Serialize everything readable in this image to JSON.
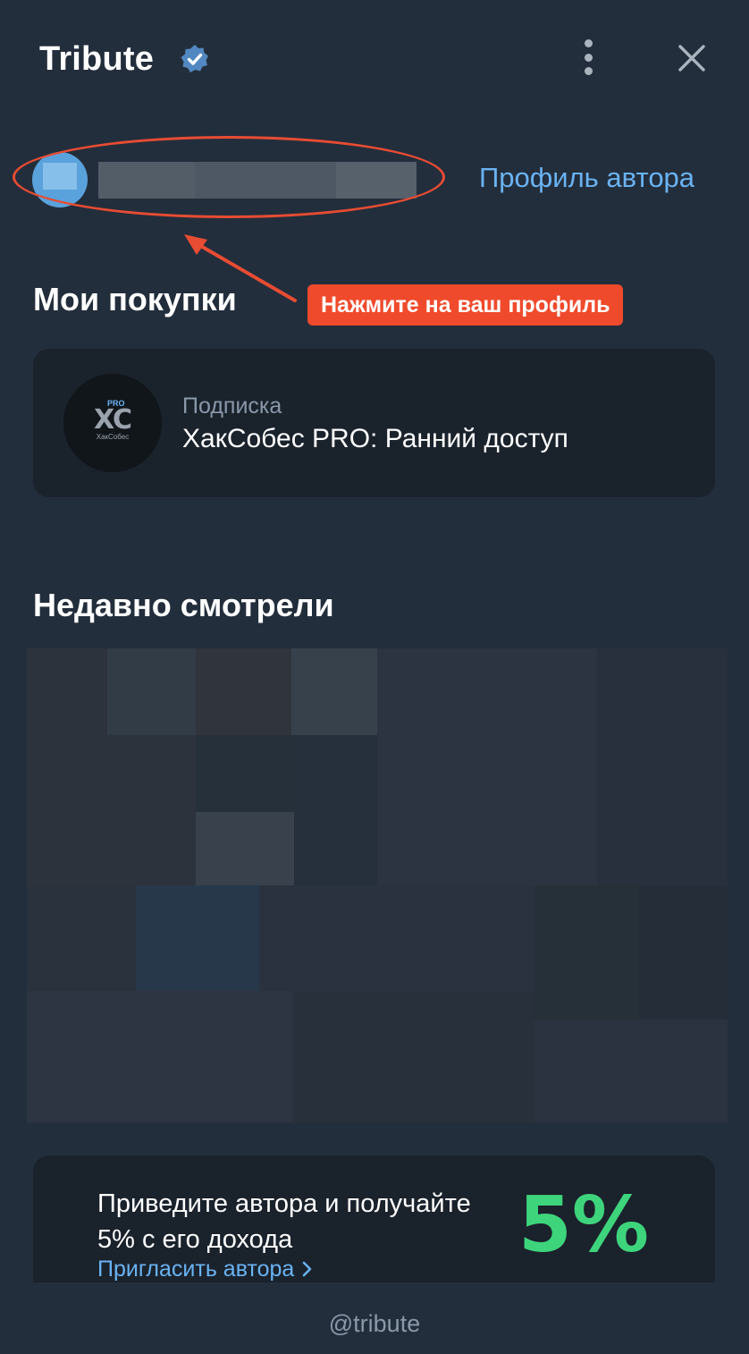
{
  "header": {
    "title": "Tribute",
    "verified_icon": "verified-badge-icon",
    "menu_icon": "more-vertical-icon",
    "close_icon": "close-icon"
  },
  "profile": {
    "author_link": "Профиль автора",
    "callout": "Нажмите на ваш профиль"
  },
  "purchases": {
    "title": "Мои покупки",
    "items": [
      {
        "type": "Подписка",
        "name": "ХакСобес PRO: Ранний доступ",
        "logo_mark": "XC",
        "logo_badge": "PRO",
        "logo_caption": "ХакСобес"
      }
    ]
  },
  "recent": {
    "title": "Недавно смотрели"
  },
  "referral": {
    "text": "Приведите автора и получайте 5% с его дохода",
    "link": "Пригласить автора",
    "percent": "5%"
  },
  "footer": {
    "handle": "@tribute"
  },
  "colors": {
    "background": "#232e3c",
    "card": "#1a222c",
    "link": "#6ab3f3",
    "accent_green": "#3ed47c",
    "annotation_red": "#e84c33"
  }
}
